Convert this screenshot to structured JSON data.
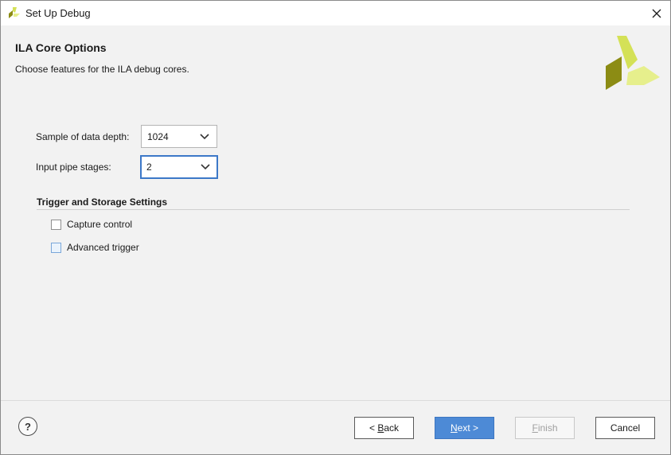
{
  "window": {
    "title": "Set Up Debug"
  },
  "header": {
    "title": "ILA Core Options",
    "subtitle": "Choose features for the ILA debug cores."
  },
  "form": {
    "depth": {
      "label": "Sample of data depth:",
      "value": "1024"
    },
    "pipe": {
      "label": "Input pipe stages:",
      "value": "2"
    }
  },
  "section": {
    "title": "Trigger and Storage Settings",
    "options": [
      {
        "label": "Capture control",
        "checked": false
      },
      {
        "label": "Advanced trigger",
        "checked": false
      }
    ]
  },
  "footer": {
    "help": "?",
    "back": {
      "prefix": "< ",
      "mnemonic": "B",
      "rest": "ack"
    },
    "next": {
      "mnemonic": "N",
      "rest": "ext >"
    },
    "finish": {
      "mnemonic": "F",
      "rest": "inish"
    },
    "cancel": "Cancel"
  },
  "colors": {
    "accent": "#4d8ad6",
    "focus": "#3c78c8",
    "logo_light": "#d4e157",
    "logo_pale": "#e6ef8c",
    "logo_dark": "#8c8c14"
  },
  "icons": {
    "app": "app-logo-icon",
    "close": "close-icon",
    "combo": "chevron-down-icon",
    "help": "help-icon"
  }
}
